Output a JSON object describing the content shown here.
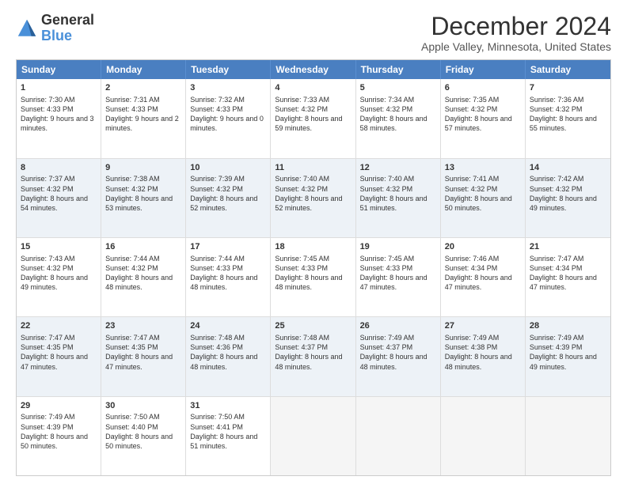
{
  "logo": {
    "text_general": "General",
    "text_blue": "Blue"
  },
  "title": "December 2024",
  "subtitle": "Apple Valley, Minnesota, United States",
  "days_of_week": [
    "Sunday",
    "Monday",
    "Tuesday",
    "Wednesday",
    "Thursday",
    "Friday",
    "Saturday"
  ],
  "weeks": [
    [
      {
        "day": "1",
        "sunrise": "7:30 AM",
        "sunset": "4:33 PM",
        "daylight": "9 hours and 3 minutes."
      },
      {
        "day": "2",
        "sunrise": "7:31 AM",
        "sunset": "4:33 PM",
        "daylight": "9 hours and 2 minutes."
      },
      {
        "day": "3",
        "sunrise": "7:32 AM",
        "sunset": "4:33 PM",
        "daylight": "9 hours and 0 minutes."
      },
      {
        "day": "4",
        "sunrise": "7:33 AM",
        "sunset": "4:32 PM",
        "daylight": "8 hours and 59 minutes."
      },
      {
        "day": "5",
        "sunrise": "7:34 AM",
        "sunset": "4:32 PM",
        "daylight": "8 hours and 58 minutes."
      },
      {
        "day": "6",
        "sunrise": "7:35 AM",
        "sunset": "4:32 PM",
        "daylight": "8 hours and 57 minutes."
      },
      {
        "day": "7",
        "sunrise": "7:36 AM",
        "sunset": "4:32 PM",
        "daylight": "8 hours and 55 minutes."
      }
    ],
    [
      {
        "day": "8",
        "sunrise": "7:37 AM",
        "sunset": "4:32 PM",
        "daylight": "8 hours and 54 minutes."
      },
      {
        "day": "9",
        "sunrise": "7:38 AM",
        "sunset": "4:32 PM",
        "daylight": "8 hours and 53 minutes."
      },
      {
        "day": "10",
        "sunrise": "7:39 AM",
        "sunset": "4:32 PM",
        "daylight": "8 hours and 52 minutes."
      },
      {
        "day": "11",
        "sunrise": "7:40 AM",
        "sunset": "4:32 PM",
        "daylight": "8 hours and 52 minutes."
      },
      {
        "day": "12",
        "sunrise": "7:40 AM",
        "sunset": "4:32 PM",
        "daylight": "8 hours and 51 minutes."
      },
      {
        "day": "13",
        "sunrise": "7:41 AM",
        "sunset": "4:32 PM",
        "daylight": "8 hours and 50 minutes."
      },
      {
        "day": "14",
        "sunrise": "7:42 AM",
        "sunset": "4:32 PM",
        "daylight": "8 hours and 49 minutes."
      }
    ],
    [
      {
        "day": "15",
        "sunrise": "7:43 AM",
        "sunset": "4:32 PM",
        "daylight": "8 hours and 49 minutes."
      },
      {
        "day": "16",
        "sunrise": "7:44 AM",
        "sunset": "4:32 PM",
        "daylight": "8 hours and 48 minutes."
      },
      {
        "day": "17",
        "sunrise": "7:44 AM",
        "sunset": "4:33 PM",
        "daylight": "8 hours and 48 minutes."
      },
      {
        "day": "18",
        "sunrise": "7:45 AM",
        "sunset": "4:33 PM",
        "daylight": "8 hours and 48 minutes."
      },
      {
        "day": "19",
        "sunrise": "7:45 AM",
        "sunset": "4:33 PM",
        "daylight": "8 hours and 47 minutes."
      },
      {
        "day": "20",
        "sunrise": "7:46 AM",
        "sunset": "4:34 PM",
        "daylight": "8 hours and 47 minutes."
      },
      {
        "day": "21",
        "sunrise": "7:47 AM",
        "sunset": "4:34 PM",
        "daylight": "8 hours and 47 minutes."
      }
    ],
    [
      {
        "day": "22",
        "sunrise": "7:47 AM",
        "sunset": "4:35 PM",
        "daylight": "8 hours and 47 minutes."
      },
      {
        "day": "23",
        "sunrise": "7:47 AM",
        "sunset": "4:35 PM",
        "daylight": "8 hours and 47 minutes."
      },
      {
        "day": "24",
        "sunrise": "7:48 AM",
        "sunset": "4:36 PM",
        "daylight": "8 hours and 48 minutes."
      },
      {
        "day": "25",
        "sunrise": "7:48 AM",
        "sunset": "4:37 PM",
        "daylight": "8 hours and 48 minutes."
      },
      {
        "day": "26",
        "sunrise": "7:49 AM",
        "sunset": "4:37 PM",
        "daylight": "8 hours and 48 minutes."
      },
      {
        "day": "27",
        "sunrise": "7:49 AM",
        "sunset": "4:38 PM",
        "daylight": "8 hours and 48 minutes."
      },
      {
        "day": "28",
        "sunrise": "7:49 AM",
        "sunset": "4:39 PM",
        "daylight": "8 hours and 49 minutes."
      }
    ],
    [
      {
        "day": "29",
        "sunrise": "7:49 AM",
        "sunset": "4:39 PM",
        "daylight": "8 hours and 50 minutes."
      },
      {
        "day": "30",
        "sunrise": "7:50 AM",
        "sunset": "4:40 PM",
        "daylight": "8 hours and 50 minutes."
      },
      {
        "day": "31",
        "sunrise": "7:50 AM",
        "sunset": "4:41 PM",
        "daylight": "8 hours and 51 minutes."
      },
      null,
      null,
      null,
      null
    ]
  ]
}
